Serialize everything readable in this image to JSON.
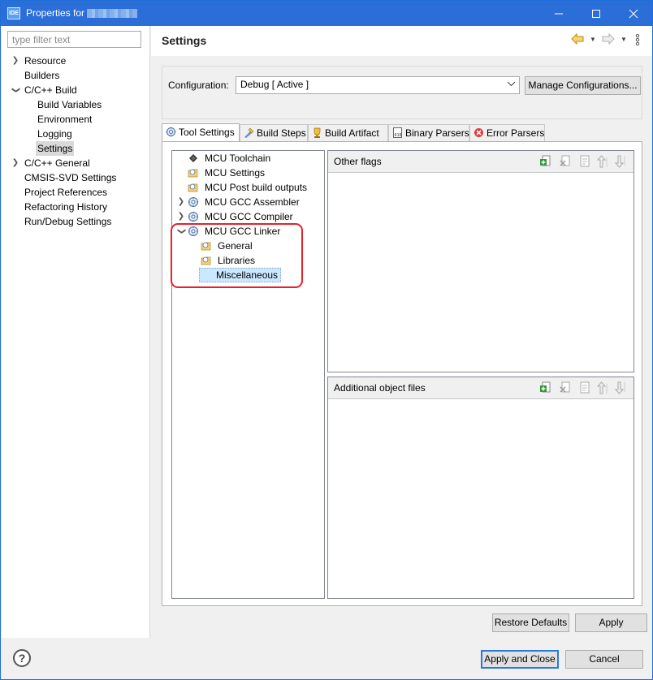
{
  "window": {
    "title": "Properties for",
    "icon_text": "IDE"
  },
  "filter": {
    "placeholder": "type filter text",
    "value": ""
  },
  "sidebar": {
    "items": [
      {
        "label": "Resource",
        "level": 0,
        "twisty": "collapsed"
      },
      {
        "label": "Builders",
        "level": 0,
        "twisty": "none"
      },
      {
        "label": "C/C++ Build",
        "level": 0,
        "twisty": "expanded"
      },
      {
        "label": "Build Variables",
        "level": 1,
        "twisty": "none"
      },
      {
        "label": "Environment",
        "level": 1,
        "twisty": "none"
      },
      {
        "label": "Logging",
        "level": 1,
        "twisty": "none"
      },
      {
        "label": "Settings",
        "level": 1,
        "twisty": "none",
        "selected": true
      },
      {
        "label": "C/C++ General",
        "level": 0,
        "twisty": "collapsed"
      },
      {
        "label": "CMSIS-SVD Settings",
        "level": 0,
        "twisty": "none"
      },
      {
        "label": "Project References",
        "level": 0,
        "twisty": "none"
      },
      {
        "label": "Refactoring History",
        "level": 0,
        "twisty": "none"
      },
      {
        "label": "Run/Debug Settings",
        "level": 0,
        "twisty": "none"
      }
    ]
  },
  "header": {
    "title": "Settings"
  },
  "config": {
    "label": "Configuration:",
    "selected": "Debug  [ Active ]",
    "manage_button": "Manage Configurations..."
  },
  "tabs": [
    {
      "label": "Tool Settings",
      "icon": "tool-settings-icon",
      "active": true
    },
    {
      "label": "Build Steps",
      "icon": "build-steps-icon"
    },
    {
      "label": "Build Artifact",
      "icon": "build-artifact-icon"
    },
    {
      "label": "Binary Parsers",
      "icon": "binary-parsers-icon"
    },
    {
      "label": "Error Parsers",
      "icon": "error-parsers-icon"
    }
  ],
  "tool_tree": [
    {
      "label": "MCU Toolchain",
      "icon": "chip",
      "indent": 0,
      "twisty": "none"
    },
    {
      "label": "MCU Settings",
      "icon": "folder",
      "indent": 0,
      "twisty": "none"
    },
    {
      "label": "MCU Post build outputs",
      "icon": "folder",
      "indent": 0,
      "twisty": "none"
    },
    {
      "label": "MCU GCC Assembler",
      "icon": "gear",
      "indent": 0,
      "twisty": "collapsed"
    },
    {
      "label": "MCU GCC Compiler",
      "icon": "gear",
      "indent": 0,
      "twisty": "collapsed"
    },
    {
      "label": "MCU GCC Linker",
      "icon": "gear",
      "indent": 0,
      "twisty": "expanded"
    },
    {
      "label": "General",
      "icon": "folder",
      "indent": 1,
      "twisty": "none"
    },
    {
      "label": "Libraries",
      "icon": "folder",
      "indent": 1,
      "twisty": "none"
    },
    {
      "label": "Miscellaneous",
      "icon": "folder",
      "indent": 1,
      "twisty": "none",
      "selected": true
    }
  ],
  "panels": {
    "other_flags": {
      "title": "Other flags"
    },
    "additional_objects": {
      "title": "Additional object files"
    },
    "list_icons": [
      "add-icon",
      "delete-icon",
      "edit-icon",
      "move-up-icon",
      "move-down-icon"
    ]
  },
  "buttons": {
    "restore_defaults": "Restore Defaults",
    "apply": "Apply",
    "apply_and_close": "Apply and Close",
    "cancel": "Cancel"
  },
  "colors": {
    "titlebar": "#2b6ed8",
    "selection": "#cce8ff",
    "highlight_mark": "#e8202a"
  }
}
